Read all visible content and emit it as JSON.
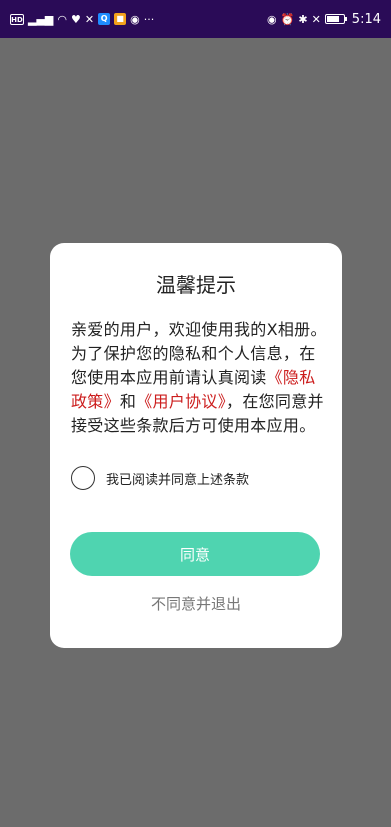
{
  "status_bar": {
    "left_icons": [
      "hd-icon",
      "signal-icon",
      "wifi-icon",
      "heart-icon",
      "translate-icon",
      "qq-icon",
      "app-icon",
      "camera-icon",
      "more-icon"
    ],
    "hd_label": "HD",
    "more_label": "···",
    "time": "5:14",
    "right_icons": [
      "eye-icon",
      "alarm-icon",
      "bluetooth-icon",
      "mute-icon",
      "battery-icon"
    ]
  },
  "dialog": {
    "title": "温馨提示",
    "body_part1": "亲爱的用户，欢迎使用我的X相册。为了保护您的隐私和个人信息，在您使用本应用前请认真阅读",
    "privacy_link": "《隐私政策》",
    "and_text": "和",
    "terms_link": "《用户协议》",
    "body_part2": "，在您同意并接受这些条款后方可使用本应用。",
    "agree_checkbox_label": "我已阅读并同意上述条款",
    "agree_button": "同意",
    "decline_link": "不同意并退出"
  },
  "colors": {
    "status_bar_bg": "#2a0b57",
    "backdrop": "#6c6c6c",
    "accent": "#4fd4b0",
    "link": "#cc1d1d"
  }
}
